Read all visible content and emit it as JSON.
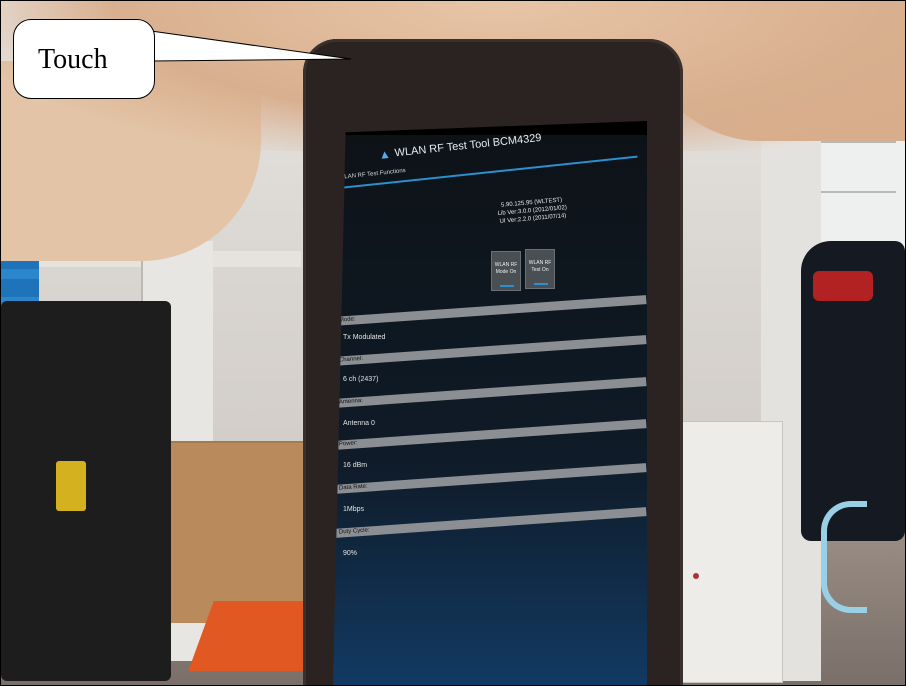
{
  "callout": {
    "label": "Touch"
  },
  "app": {
    "title": "WLAN RF Test Tool BCM4329",
    "section": "WLAN RF Test Functions",
    "versions": [
      "5.90.125.95 (WLTEST)",
      "Lib Ver:3.0.0 (2012/01/02)",
      "UI Ver:2.2.0 (2011/07/14)"
    ],
    "buttons": [
      {
        "line1": "WLAN RF",
        "line2": "Mode On"
      },
      {
        "line1": "WLAN RF",
        "line2": "Test On"
      }
    ],
    "fields": [
      {
        "label": "Mode:",
        "value": "Tx Modulated"
      },
      {
        "label": "Channel:",
        "value": "6 ch (2437)"
      },
      {
        "label": "Antenna:",
        "value": "Antenna 0"
      },
      {
        "label": "Power:",
        "value": "16 dBm"
      },
      {
        "label": "Data Rate:",
        "value": "1Mbps"
      },
      {
        "label": "Duty Cycle:",
        "value": "90%"
      }
    ]
  },
  "colors": {
    "accent": "#2c8fd0",
    "callout_border": "#000000"
  },
  "icons": {
    "app_icon": "antenna-icon"
  }
}
